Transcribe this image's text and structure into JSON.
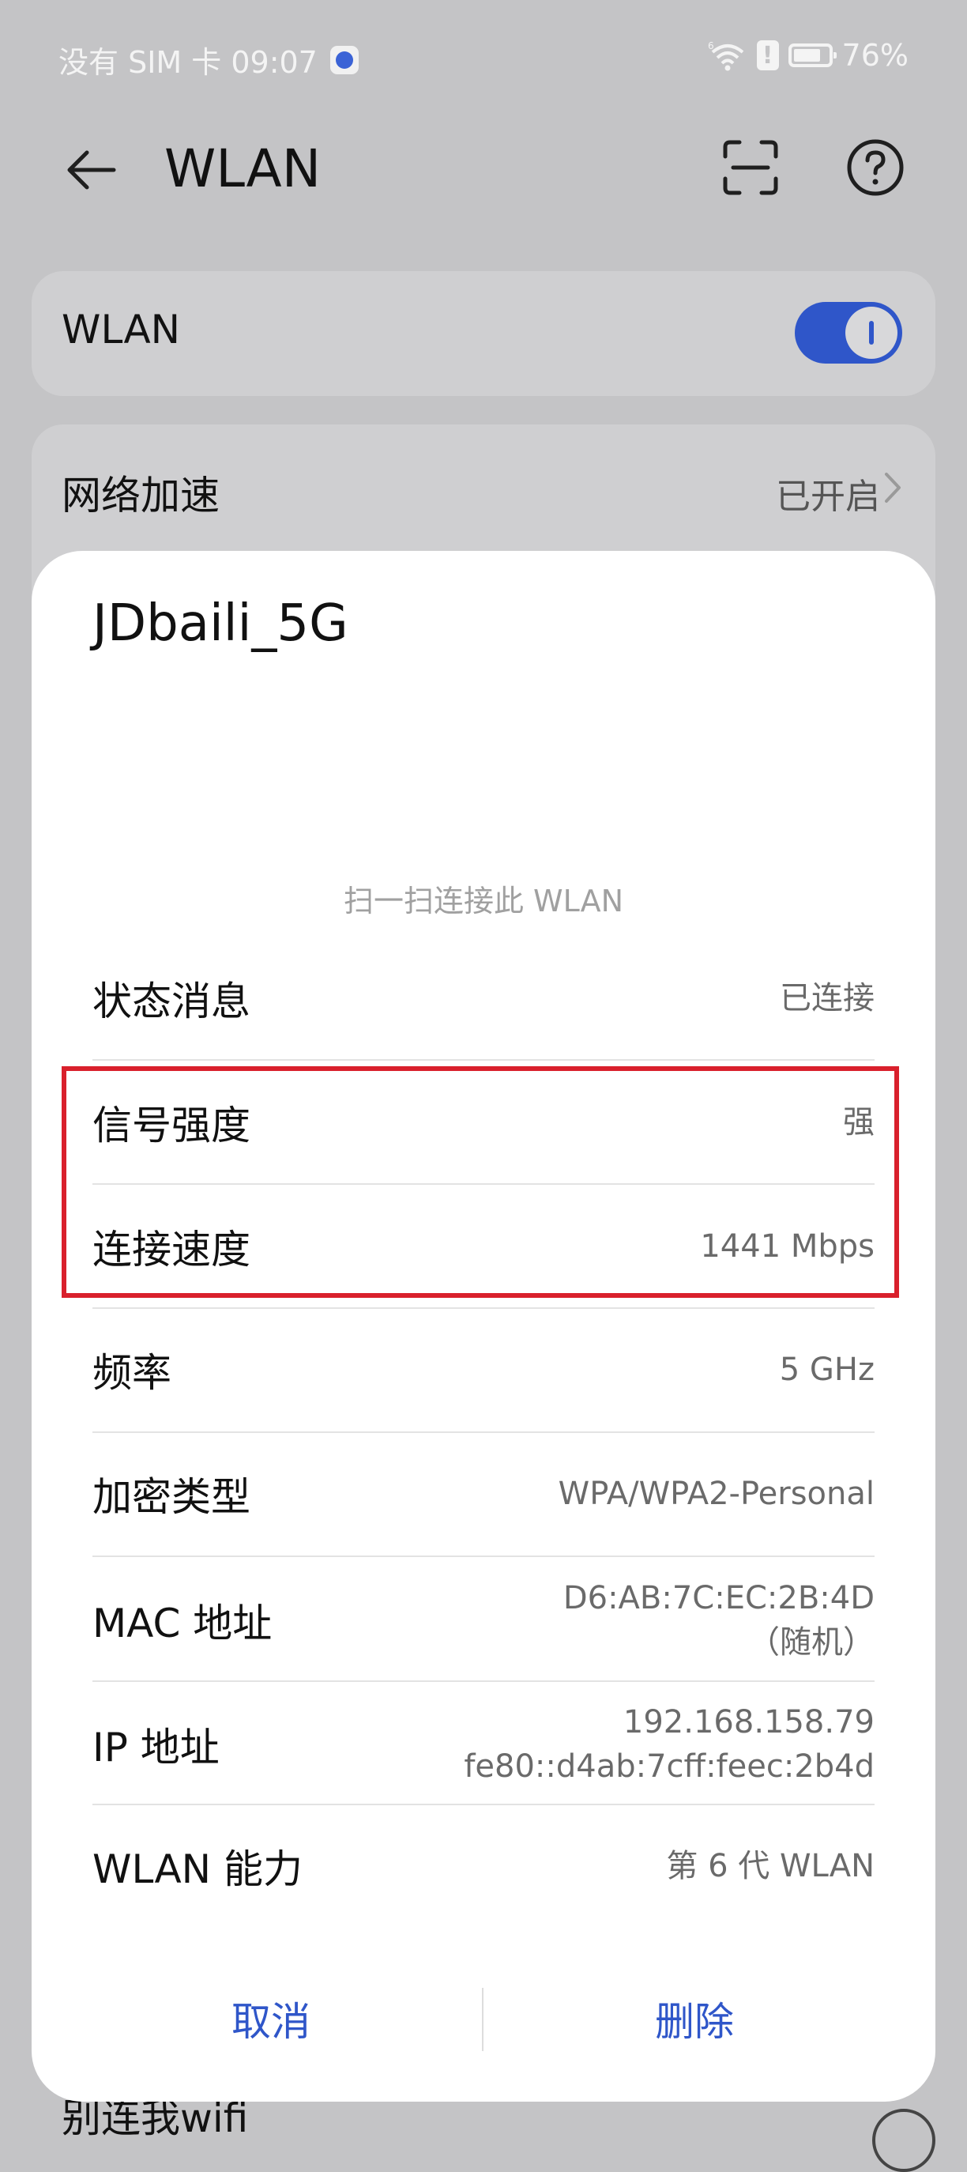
{
  "status_bar": {
    "left_text": "没有 SIM 卡 09:07",
    "battery": "76%",
    "wifi_label": "6",
    "alert": "!"
  },
  "header": {
    "title": "WLAN",
    "back_icon": "arrow-left-icon",
    "scan_icon": "scan-icon",
    "help_icon": "help-icon"
  },
  "wlan_card": {
    "label": "WLAN",
    "toggle_on": true
  },
  "accel_card": {
    "label": "网络加速",
    "value": "已开启"
  },
  "below_item": "别连我wifi",
  "dialog": {
    "ssid": "JDbaili_5G",
    "scan_hint": "扫一扫连接此 WLAN",
    "rows": {
      "status": {
        "label": "状态消息",
        "value": "已连接"
      },
      "signal": {
        "label": "信号强度",
        "value": "强"
      },
      "speed": {
        "label": "连接速度",
        "value": "1441 Mbps"
      },
      "freq": {
        "label": "频率",
        "value": "5 GHz"
      },
      "encrypt": {
        "label": "加密类型",
        "value": "WPA/WPA2-Personal"
      },
      "mac": {
        "label": "MAC 地址",
        "value": "D6:AB:7C:EC:2B:4D",
        "value2": "（随机）"
      },
      "ip": {
        "label": "IP 地址",
        "value": "192.168.158.79",
        "value2": "fe80::d4ab:7cff:feec:2b4d"
      },
      "capability": {
        "label": "WLAN 能力",
        "value": "第 6 代 WLAN"
      }
    },
    "cancel_label": "取消",
    "delete_label": "删除"
  },
  "colors": {
    "accent": "#2f56c9",
    "highlight": "#d9202c",
    "backdrop": "#c4c4c6"
  }
}
